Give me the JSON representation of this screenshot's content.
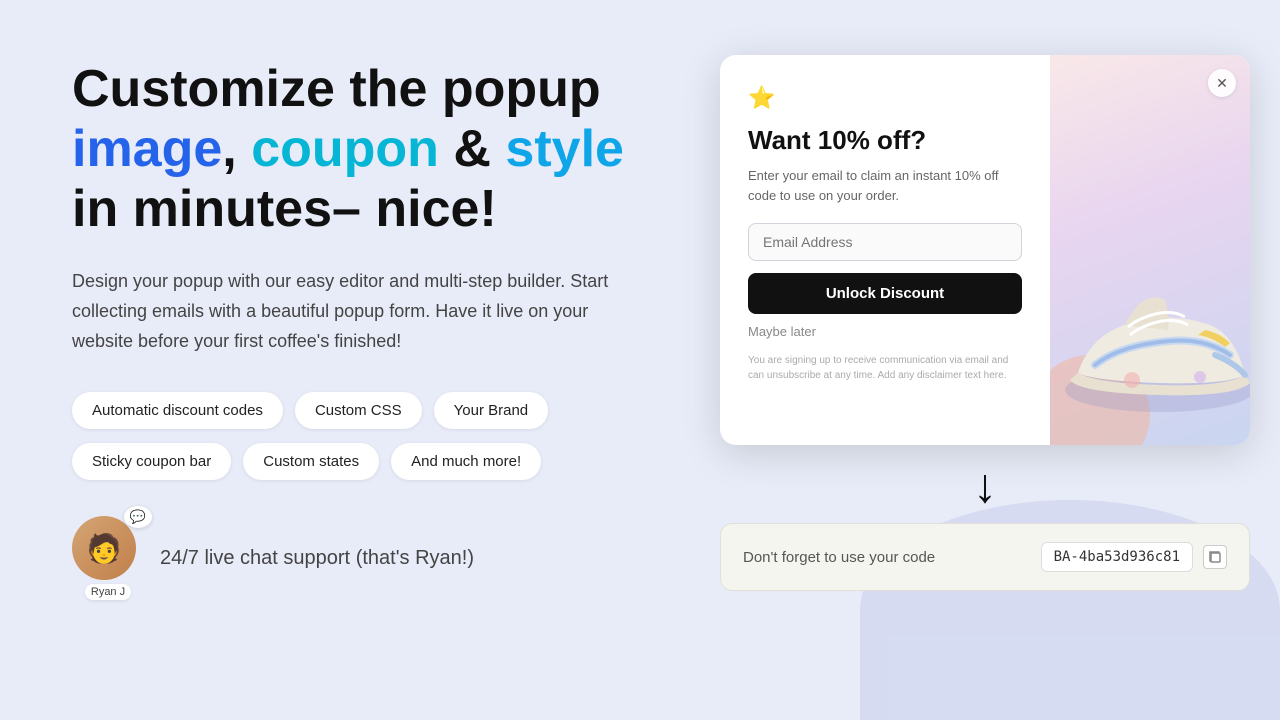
{
  "heading": {
    "line1": "Customize the popup",
    "word_image": "image",
    "word_coupon": "coupon",
    "ampersand": " & ",
    "word_style": "style",
    "line3": "in minutes– nice!"
  },
  "description": "Design your popup with our easy editor and multi-step builder. Start collecting emails with a beautiful popup form. Have it live on your website before your first coffee's finished!",
  "tags": [
    "Automatic discount codes",
    "Custom CSS",
    "Your Brand",
    "Sticky coupon bar",
    "Custom states",
    "And much more!"
  ],
  "support": {
    "text": "24/7 live chat support",
    "subtext": "(that's Ryan!)",
    "agent_name": "Ryan J"
  },
  "popup": {
    "close_label": "✕",
    "star_emoji": "⭐",
    "heading": "Want 10% off?",
    "subtext": "Enter your email to claim an instant 10% off code to use on your order.",
    "email_placeholder": "Email Address",
    "button_label": "Unlock Discount",
    "maybe_later": "Maybe later",
    "disclaimer": "You are signing up to receive communication via email and can unsubscribe at any time. Add any disclaimer text here."
  },
  "coupon_bar": {
    "label": "Don't forget to use your code",
    "code": "BA-4ba53d936c81"
  },
  "arrow": "↓",
  "colors": {
    "blue": "#2563eb",
    "cyan": "#06b6d4",
    "teal": "#0ea5e9",
    "dark": "#111111"
  }
}
